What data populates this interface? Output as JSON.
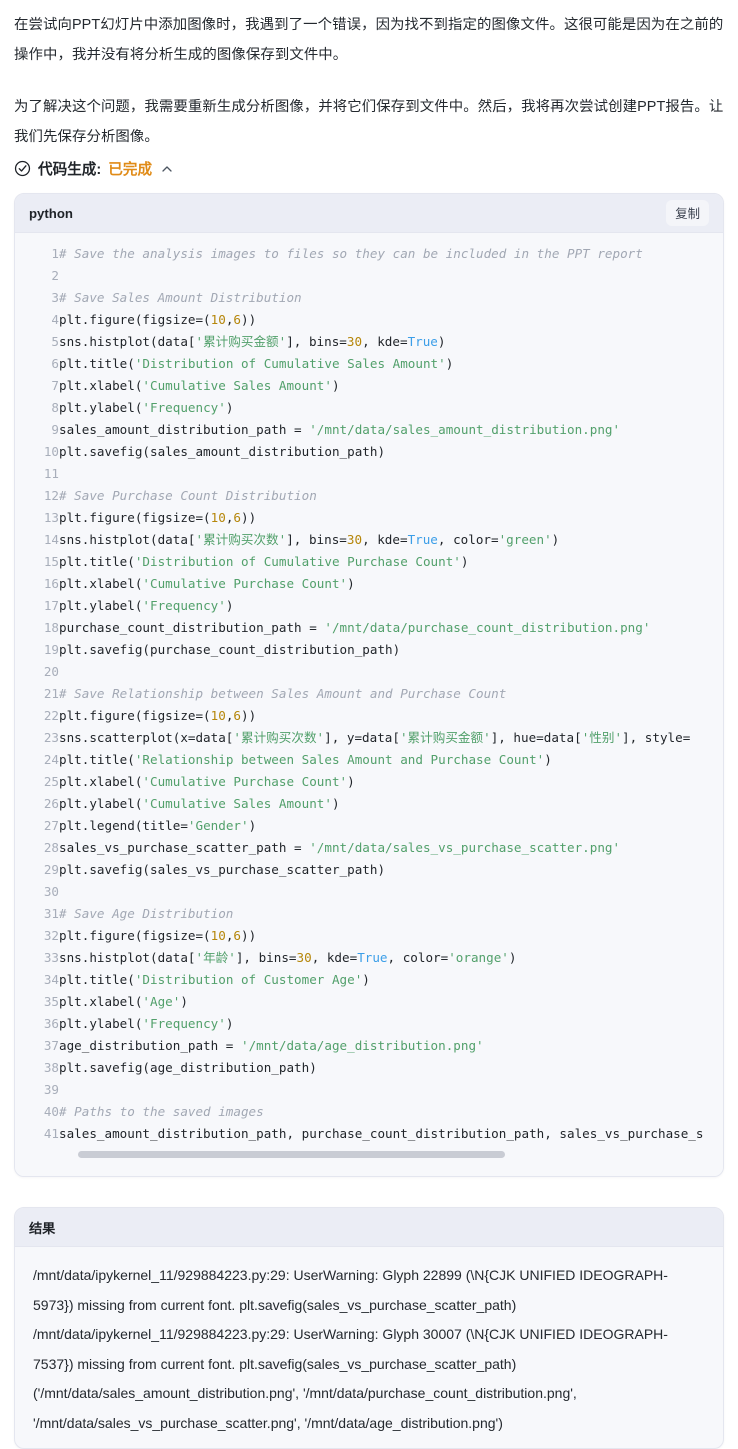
{
  "prose": {
    "paragraph_1": "在尝试向PPT幻灯片中添加图像时，我遇到了一个错误，因为找不到指定的图像文件。这很可能是因为在之前的操作中，我并没有将分析生成的图像保存到文件中。",
    "paragraph_2": "为了解决这个问题，我需要重新生成分析图像，并将它们保存到文件中。然后，我将再次尝试创建PPT报告。让我们先保存分析图像。"
  },
  "status": {
    "icon": "check-circle-icon",
    "label": "代码生成:",
    "value": "已完成",
    "chevron": "chevron-up-icon",
    "value_color": "#e08b17"
  },
  "code_block": {
    "language": "python",
    "copy_label": "复制",
    "scrollbar": {
      "thumb_percent": 67
    },
    "lines": [
      {
        "n": 1,
        "tokens": [
          {
            "t": "com",
            "v": "# Save the analysis images to files so they can be included in the PPT report"
          }
        ]
      },
      {
        "n": 2,
        "tokens": []
      },
      {
        "n": 3,
        "tokens": [
          {
            "t": "com",
            "v": "# Save Sales Amount Distribution"
          }
        ]
      },
      {
        "n": 4,
        "tokens": [
          {
            "t": "pl",
            "v": "plt.figure(figsize=("
          },
          {
            "t": "num",
            "v": "10"
          },
          {
            "t": "pl",
            "v": ","
          },
          {
            "t": "num",
            "v": "6"
          },
          {
            "t": "pl",
            "v": "))"
          }
        ]
      },
      {
        "n": 5,
        "tokens": [
          {
            "t": "pl",
            "v": "sns.histplot(data["
          },
          {
            "t": "str",
            "v": "'累计购买金额'"
          },
          {
            "t": "pl",
            "v": "], bins="
          },
          {
            "t": "num",
            "v": "30"
          },
          {
            "t": "pl",
            "v": ", kde="
          },
          {
            "t": "kw",
            "v": "True"
          },
          {
            "t": "pl",
            "v": ")"
          }
        ]
      },
      {
        "n": 6,
        "tokens": [
          {
            "t": "pl",
            "v": "plt.title("
          },
          {
            "t": "str",
            "v": "'Distribution of Cumulative Sales Amount'"
          },
          {
            "t": "pl",
            "v": ")"
          }
        ]
      },
      {
        "n": 7,
        "tokens": [
          {
            "t": "pl",
            "v": "plt.xlabel("
          },
          {
            "t": "str",
            "v": "'Cumulative Sales Amount'"
          },
          {
            "t": "pl",
            "v": ")"
          }
        ]
      },
      {
        "n": 8,
        "tokens": [
          {
            "t": "pl",
            "v": "plt.ylabel("
          },
          {
            "t": "str",
            "v": "'Frequency'"
          },
          {
            "t": "pl",
            "v": ")"
          }
        ]
      },
      {
        "n": 9,
        "tokens": [
          {
            "t": "pl",
            "v": "sales_amount_distribution_path = "
          },
          {
            "t": "str",
            "v": "'/mnt/data/sales_amount_distribution.png'"
          }
        ]
      },
      {
        "n": 10,
        "tokens": [
          {
            "t": "pl",
            "v": "plt.savefig(sales_amount_distribution_path)"
          }
        ]
      },
      {
        "n": 11,
        "tokens": []
      },
      {
        "n": 12,
        "tokens": [
          {
            "t": "com",
            "v": "# Save Purchase Count Distribution"
          }
        ]
      },
      {
        "n": 13,
        "tokens": [
          {
            "t": "pl",
            "v": "plt.figure(figsize=("
          },
          {
            "t": "num",
            "v": "10"
          },
          {
            "t": "pl",
            "v": ","
          },
          {
            "t": "num",
            "v": "6"
          },
          {
            "t": "pl",
            "v": "))"
          }
        ]
      },
      {
        "n": 14,
        "tokens": [
          {
            "t": "pl",
            "v": "sns.histplot(data["
          },
          {
            "t": "str",
            "v": "'累计购买次数'"
          },
          {
            "t": "pl",
            "v": "], bins="
          },
          {
            "t": "num",
            "v": "30"
          },
          {
            "t": "pl",
            "v": ", kde="
          },
          {
            "t": "kw",
            "v": "True"
          },
          {
            "t": "pl",
            "v": ", color="
          },
          {
            "t": "str",
            "v": "'green'"
          },
          {
            "t": "pl",
            "v": ")"
          }
        ]
      },
      {
        "n": 15,
        "tokens": [
          {
            "t": "pl",
            "v": "plt.title("
          },
          {
            "t": "str",
            "v": "'Distribution of Cumulative Purchase Count'"
          },
          {
            "t": "pl",
            "v": ")"
          }
        ]
      },
      {
        "n": 16,
        "tokens": [
          {
            "t": "pl",
            "v": "plt.xlabel("
          },
          {
            "t": "str",
            "v": "'Cumulative Purchase Count'"
          },
          {
            "t": "pl",
            "v": ")"
          }
        ]
      },
      {
        "n": 17,
        "tokens": [
          {
            "t": "pl",
            "v": "plt.ylabel("
          },
          {
            "t": "str",
            "v": "'Frequency'"
          },
          {
            "t": "pl",
            "v": ")"
          }
        ]
      },
      {
        "n": 18,
        "tokens": [
          {
            "t": "pl",
            "v": "purchase_count_distribution_path = "
          },
          {
            "t": "str",
            "v": "'/mnt/data/purchase_count_distribution.png'"
          }
        ]
      },
      {
        "n": 19,
        "tokens": [
          {
            "t": "pl",
            "v": "plt.savefig(purchase_count_distribution_path)"
          }
        ]
      },
      {
        "n": 20,
        "tokens": []
      },
      {
        "n": 21,
        "tokens": [
          {
            "t": "com",
            "v": "# Save Relationship between Sales Amount and Purchase Count"
          }
        ]
      },
      {
        "n": 22,
        "tokens": [
          {
            "t": "pl",
            "v": "plt.figure(figsize=("
          },
          {
            "t": "num",
            "v": "10"
          },
          {
            "t": "pl",
            "v": ","
          },
          {
            "t": "num",
            "v": "6"
          },
          {
            "t": "pl",
            "v": "))"
          }
        ]
      },
      {
        "n": 23,
        "tokens": [
          {
            "t": "pl",
            "v": "sns.scatterplot(x=data["
          },
          {
            "t": "str",
            "v": "'累计购买次数'"
          },
          {
            "t": "pl",
            "v": "], y=data["
          },
          {
            "t": "str",
            "v": "'累计购买金额'"
          },
          {
            "t": "pl",
            "v": "], hue=data["
          },
          {
            "t": "str",
            "v": "'性别'"
          },
          {
            "t": "pl",
            "v": "], style="
          }
        ]
      },
      {
        "n": 24,
        "tokens": [
          {
            "t": "pl",
            "v": "plt.title("
          },
          {
            "t": "str",
            "v": "'Relationship between Sales Amount and Purchase Count'"
          },
          {
            "t": "pl",
            "v": ")"
          }
        ]
      },
      {
        "n": 25,
        "tokens": [
          {
            "t": "pl",
            "v": "plt.xlabel("
          },
          {
            "t": "str",
            "v": "'Cumulative Purchase Count'"
          },
          {
            "t": "pl",
            "v": ")"
          }
        ]
      },
      {
        "n": 26,
        "tokens": [
          {
            "t": "pl",
            "v": "plt.ylabel("
          },
          {
            "t": "str",
            "v": "'Cumulative Sales Amount'"
          },
          {
            "t": "pl",
            "v": ")"
          }
        ]
      },
      {
        "n": 27,
        "tokens": [
          {
            "t": "pl",
            "v": "plt.legend(title="
          },
          {
            "t": "str",
            "v": "'Gender'"
          },
          {
            "t": "pl",
            "v": ")"
          }
        ]
      },
      {
        "n": 28,
        "tokens": [
          {
            "t": "pl",
            "v": "sales_vs_purchase_scatter_path = "
          },
          {
            "t": "str",
            "v": "'/mnt/data/sales_vs_purchase_scatter.png'"
          }
        ]
      },
      {
        "n": 29,
        "tokens": [
          {
            "t": "pl",
            "v": "plt.savefig(sales_vs_purchase_scatter_path)"
          }
        ]
      },
      {
        "n": 30,
        "tokens": []
      },
      {
        "n": 31,
        "tokens": [
          {
            "t": "com",
            "v": "# Save Age Distribution"
          }
        ]
      },
      {
        "n": 32,
        "tokens": [
          {
            "t": "pl",
            "v": "plt.figure(figsize=("
          },
          {
            "t": "num",
            "v": "10"
          },
          {
            "t": "pl",
            "v": ","
          },
          {
            "t": "num",
            "v": "6"
          },
          {
            "t": "pl",
            "v": "))"
          }
        ]
      },
      {
        "n": 33,
        "tokens": [
          {
            "t": "pl",
            "v": "sns.histplot(data["
          },
          {
            "t": "str",
            "v": "'年龄'"
          },
          {
            "t": "pl",
            "v": "], bins="
          },
          {
            "t": "num",
            "v": "30"
          },
          {
            "t": "pl",
            "v": ", kde="
          },
          {
            "t": "kw",
            "v": "True"
          },
          {
            "t": "pl",
            "v": ", color="
          },
          {
            "t": "str",
            "v": "'orange'"
          },
          {
            "t": "pl",
            "v": ")"
          }
        ]
      },
      {
        "n": 34,
        "tokens": [
          {
            "t": "pl",
            "v": "plt.title("
          },
          {
            "t": "str",
            "v": "'Distribution of Customer Age'"
          },
          {
            "t": "pl",
            "v": ")"
          }
        ]
      },
      {
        "n": 35,
        "tokens": [
          {
            "t": "pl",
            "v": "plt.xlabel("
          },
          {
            "t": "str",
            "v": "'Age'"
          },
          {
            "t": "pl",
            "v": ")"
          }
        ]
      },
      {
        "n": 36,
        "tokens": [
          {
            "t": "pl",
            "v": "plt.ylabel("
          },
          {
            "t": "str",
            "v": "'Frequency'"
          },
          {
            "t": "pl",
            "v": ")"
          }
        ]
      },
      {
        "n": 37,
        "tokens": [
          {
            "t": "pl",
            "v": "age_distribution_path = "
          },
          {
            "t": "str",
            "v": "'/mnt/data/age_distribution.png'"
          }
        ]
      },
      {
        "n": 38,
        "tokens": [
          {
            "t": "pl",
            "v": "plt.savefig(age_distribution_path)"
          }
        ]
      },
      {
        "n": 39,
        "tokens": []
      },
      {
        "n": 40,
        "tokens": [
          {
            "t": "com",
            "v": "# Paths to the saved images"
          }
        ]
      },
      {
        "n": 41,
        "tokens": [
          {
            "t": "pl",
            "v": "sales_amount_distribution_path, purchase_count_distribution_path, sales_vs_purchase_s"
          }
        ]
      }
    ]
  },
  "result_block": {
    "title": "结果",
    "lines": [
      "/mnt/data/ipykernel_11/929884223.py:29: UserWarning: Glyph 22899 (\\N{CJK UNIFIED IDEOGRAPH-5973}) missing from current font. plt.savefig(sales_vs_purchase_scatter_path)",
      "/mnt/data/ipykernel_11/929884223.py:29: UserWarning: Glyph 30007 (\\N{CJK UNIFIED IDEOGRAPH-7537}) missing from current font. plt.savefig(sales_vs_purchase_scatter_path)",
      "('/mnt/data/sales_amount_distribution.png', '/mnt/data/purchase_count_distribution.png', '/mnt/data/sales_vs_purchase_scatter.png', '/mnt/data/age_distribution.png')"
    ]
  }
}
